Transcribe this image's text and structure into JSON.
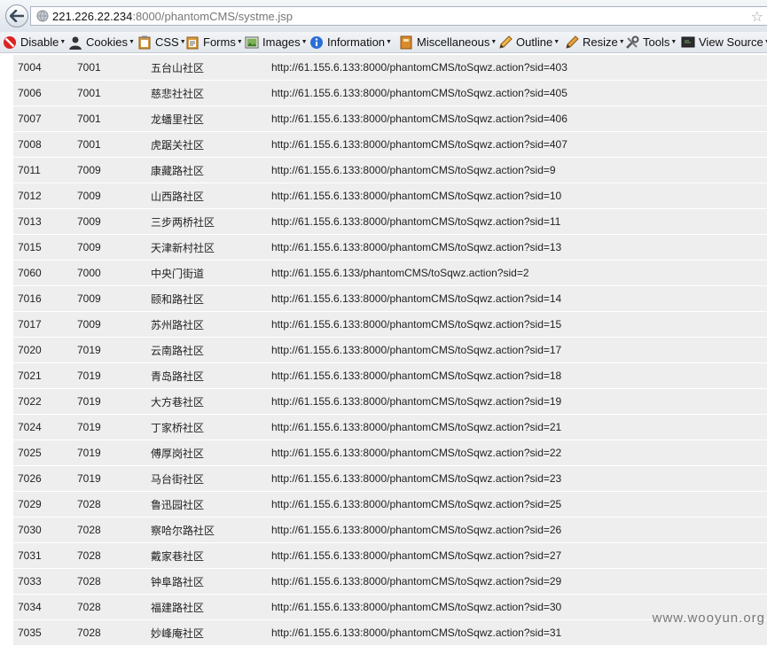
{
  "browser": {
    "url_host": "221.226.22.234",
    "url_rest": ":8000/phantomCMS/systme.jsp"
  },
  "toolbar": {
    "items": [
      {
        "label": "Disable",
        "icon": "no-entry-icon"
      },
      {
        "label": "Cookies",
        "icon": "person-icon"
      },
      {
        "label": "CSS",
        "icon": "clipboard-icon"
      },
      {
        "label": "Forms",
        "icon": "clipboard-form-icon"
      },
      {
        "label": "Images",
        "icon": "picture-icon"
      },
      {
        "label": "Information",
        "icon": "info-icon"
      },
      {
        "label": "Miscellaneous",
        "icon": "notebook-icon"
      },
      {
        "label": "Outline",
        "icon": "pencil-icon"
      },
      {
        "label": "Resize",
        "icon": "pencil-resize-icon"
      },
      {
        "label": "Tools",
        "icon": "tools-icon"
      },
      {
        "label": "View Source",
        "icon": "monitor-icon"
      }
    ]
  },
  "rows": [
    {
      "id": "7004",
      "parent": "7001",
      "name": "五台山社区",
      "url": "http://61.155.6.133:8000/phantomCMS/toSqwz.action?sid=403"
    },
    {
      "id": "7006",
      "parent": "7001",
      "name": "慈悲社社区",
      "url": "http://61.155.6.133:8000/phantomCMS/toSqwz.action?sid=405"
    },
    {
      "id": "7007",
      "parent": "7001",
      "name": "龙蟠里社区",
      "url": "http://61.155.6.133:8000/phantomCMS/toSqwz.action?sid=406"
    },
    {
      "id": "7008",
      "parent": "7001",
      "name": "虎踞关社区",
      "url": "http://61.155.6.133:8000/phantomCMS/toSqwz.action?sid=407"
    },
    {
      "id": "7011",
      "parent": "7009",
      "name": "康藏路社区",
      "url": "http://61.155.6.133:8000/phantomCMS/toSqwz.action?sid=9"
    },
    {
      "id": "7012",
      "parent": "7009",
      "name": "山西路社区",
      "url": "http://61.155.6.133:8000/phantomCMS/toSqwz.action?sid=10"
    },
    {
      "id": "7013",
      "parent": "7009",
      "name": "三步两桥社区",
      "url": "http://61.155.6.133:8000/phantomCMS/toSqwz.action?sid=11"
    },
    {
      "id": "7015",
      "parent": "7009",
      "name": "天津新村社区",
      "url": "http://61.155.6.133:8000/phantomCMS/toSqwz.action?sid=13"
    },
    {
      "id": "7060",
      "parent": "7000",
      "name": "中央门街道",
      "url": "http://61.155.6.133/phantomCMS/toSqwz.action?sid=2"
    },
    {
      "id": "7016",
      "parent": "7009",
      "name": "颐和路社区",
      "url": "http://61.155.6.133:8000/phantomCMS/toSqwz.action?sid=14"
    },
    {
      "id": "7017",
      "parent": "7009",
      "name": "苏州路社区",
      "url": "http://61.155.6.133:8000/phantomCMS/toSqwz.action?sid=15"
    },
    {
      "id": "7020",
      "parent": "7019",
      "name": "云南路社区",
      "url": "http://61.155.6.133:8000/phantomCMS/toSqwz.action?sid=17"
    },
    {
      "id": "7021",
      "parent": "7019",
      "name": "青岛路社区",
      "url": "http://61.155.6.133:8000/phantomCMS/toSqwz.action?sid=18"
    },
    {
      "id": "7022",
      "parent": "7019",
      "name": "大方巷社区",
      "url": "http://61.155.6.133:8000/phantomCMS/toSqwz.action?sid=19"
    },
    {
      "id": "7024",
      "parent": "7019",
      "name": "丁家桥社区",
      "url": "http://61.155.6.133:8000/phantomCMS/toSqwz.action?sid=21"
    },
    {
      "id": "7025",
      "parent": "7019",
      "name": "傅厚岗社区",
      "url": "http://61.155.6.133:8000/phantomCMS/toSqwz.action?sid=22"
    },
    {
      "id": "7026",
      "parent": "7019",
      "name": "马台街社区",
      "url": "http://61.155.6.133:8000/phantomCMS/toSqwz.action?sid=23"
    },
    {
      "id": "7029",
      "parent": "7028",
      "name": "鲁迅园社区",
      "url": "http://61.155.6.133:8000/phantomCMS/toSqwz.action?sid=25"
    },
    {
      "id": "7030",
      "parent": "7028",
      "name": "察哈尔路社区",
      "url": "http://61.155.6.133:8000/phantomCMS/toSqwz.action?sid=26"
    },
    {
      "id": "7031",
      "parent": "7028",
      "name": "戴家巷社区",
      "url": "http://61.155.6.133:8000/phantomCMS/toSqwz.action?sid=27"
    },
    {
      "id": "7033",
      "parent": "7028",
      "name": "钟阜路社区",
      "url": "http://61.155.6.133:8000/phantomCMS/toSqwz.action?sid=29"
    },
    {
      "id": "7034",
      "parent": "7028",
      "name": "福建路社区",
      "url": "http://61.155.6.133:8000/phantomCMS/toSqwz.action?sid=30"
    },
    {
      "id": "7035",
      "parent": "7028",
      "name": "妙峰庵社区",
      "url": "http://61.155.6.133:8000/phantomCMS/toSqwz.action?sid=31"
    }
  ],
  "watermark": "www.wooyun.org"
}
